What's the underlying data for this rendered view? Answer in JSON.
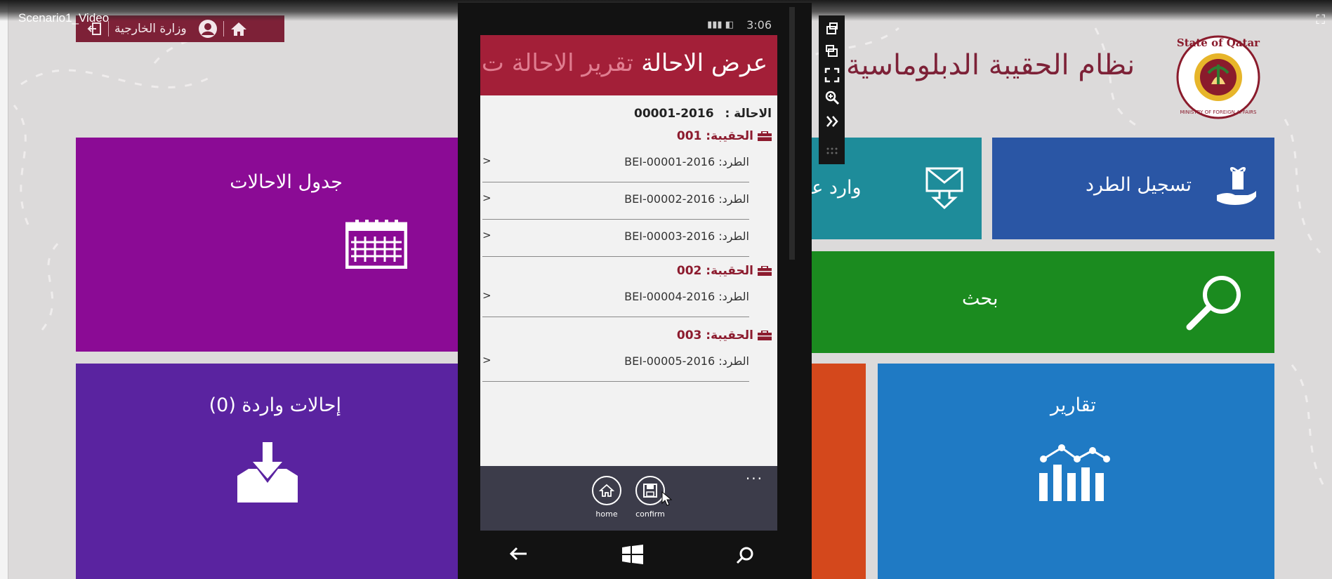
{
  "video": {
    "title": "Scenario1_Video"
  },
  "app_bar": {
    "ministry": "وزارة الخارجية"
  },
  "header": {
    "system_title": "نظام الحقيبة الدبلوماسية"
  },
  "emblem": {
    "top_text": "State of Qatar",
    "bottom_text": "MINISTRY OF FOREIGN AFFAIRS"
  },
  "tiles": {
    "table": {
      "label": "جدول الاحالات",
      "icon": "calendar-icon"
    },
    "incoming": {
      "label": "إحالات واردة (0)",
      "icon": "inbox-download-icon"
    },
    "mail": {
      "label": "وارد عا",
      "icon": "mail-download-icon"
    },
    "register": {
      "label": "تسجيل الطرد",
      "icon": "gift-hand-icon"
    },
    "search": {
      "label": "بحث",
      "icon": "magnifier-icon"
    },
    "reports": {
      "label": "تقارير",
      "icon": "bar-chart-icon"
    }
  },
  "phone": {
    "time": "3:06",
    "pivot": {
      "active": "عرض الاحالة",
      "next": "تقرير الاحالة  ت"
    },
    "reference": {
      "label": "الاحالة :",
      "value": "2016-00001"
    },
    "bags": [
      {
        "label": "الحقيبة: 001",
        "packages": [
          "الطرد: 2016-00001-BEI",
          "الطرد: 2016-00002-BEI",
          "الطرد: 2016-00003-BEI"
        ]
      },
      {
        "label": "الحقيبة: 002",
        "packages": [
          "الطرد: 2016-00004-BEI"
        ]
      },
      {
        "label": "الحقيبة: 003",
        "packages": [
          "الطرد: 2016-00005-BEI"
        ]
      }
    ],
    "chevron": "<",
    "appbar": {
      "home": "home",
      "confirm": "confirm",
      "more": "..."
    }
  },
  "colors": {
    "brand": "#7d2137",
    "purple": "#8b0b95",
    "violet": "#5a23a0",
    "teal": "#1e8c9a",
    "blue": "#2a56a5",
    "green": "#1b8b1f",
    "orange": "#d4481c",
    "sky": "#1f7ac4"
  }
}
